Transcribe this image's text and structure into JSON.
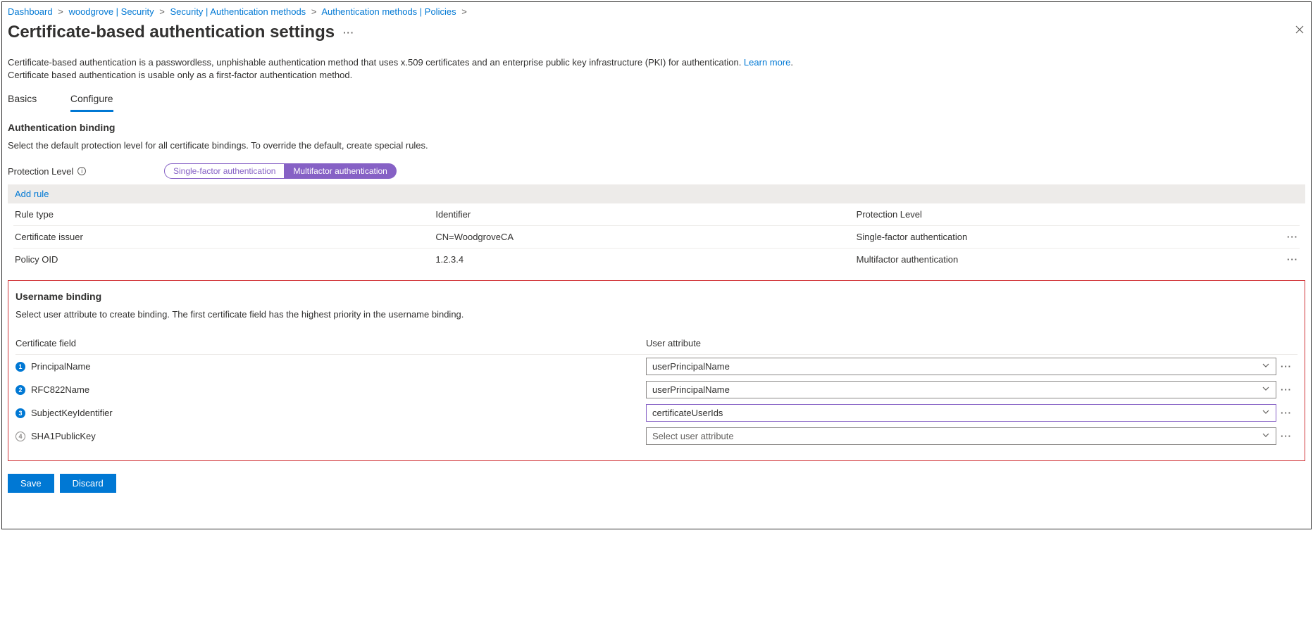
{
  "breadcrumb": [
    "Dashboard",
    "woodgrove | Security",
    "Security | Authentication methods",
    "Authentication methods | Policies"
  ],
  "page_title": "Certificate-based authentication settings",
  "description_line1": "Certificate-based authentication is a passwordless, unphishable authentication method that uses x.509 certificates and an enterprise public key infrastructure (PKI) for authentication. ",
  "learn_more": "Learn more",
  "description_line2": "Certificate based authentication is usable only as a first-factor authentication method.",
  "tabs": {
    "basics": "Basics",
    "configure": "Configure"
  },
  "auth_binding": {
    "heading": "Authentication binding",
    "subtext": "Select the default protection level for all certificate bindings. To override the default, create special rules.",
    "protection_label": "Protection Level",
    "pill_single": "Single-factor authentication",
    "pill_multi": "Multifactor authentication",
    "add_rule": "Add rule",
    "columns": {
      "rule_type": "Rule type",
      "identifier": "Identifier",
      "protection": "Protection Level"
    },
    "rows": [
      {
        "rule_type": "Certificate issuer",
        "identifier": "CN=WoodgroveCA",
        "protection": "Single-factor authentication"
      },
      {
        "rule_type": "Policy OID",
        "identifier": "1.2.3.4",
        "protection": "Multifactor authentication"
      }
    ]
  },
  "username_binding": {
    "heading": "Username binding",
    "subtext": "Select user attribute to create binding. The first certificate field has the highest priority in the username binding.",
    "col_cert": "Certificate field",
    "col_user": "User attribute",
    "rows": [
      {
        "num": "1",
        "filled": true,
        "cert": "PrincipalName",
        "attr": "userPrincipalName",
        "purple": false,
        "placeholder": false
      },
      {
        "num": "2",
        "filled": true,
        "cert": "RFC822Name",
        "attr": "userPrincipalName",
        "purple": false,
        "placeholder": false
      },
      {
        "num": "3",
        "filled": true,
        "cert": "SubjectKeyIdentifier",
        "attr": "certificateUserIds",
        "purple": true,
        "placeholder": false
      },
      {
        "num": "4",
        "filled": false,
        "cert": "SHA1PublicKey",
        "attr": "Select user attribute",
        "purple": false,
        "placeholder": true
      }
    ]
  },
  "footer": {
    "save": "Save",
    "discard": "Discard"
  }
}
